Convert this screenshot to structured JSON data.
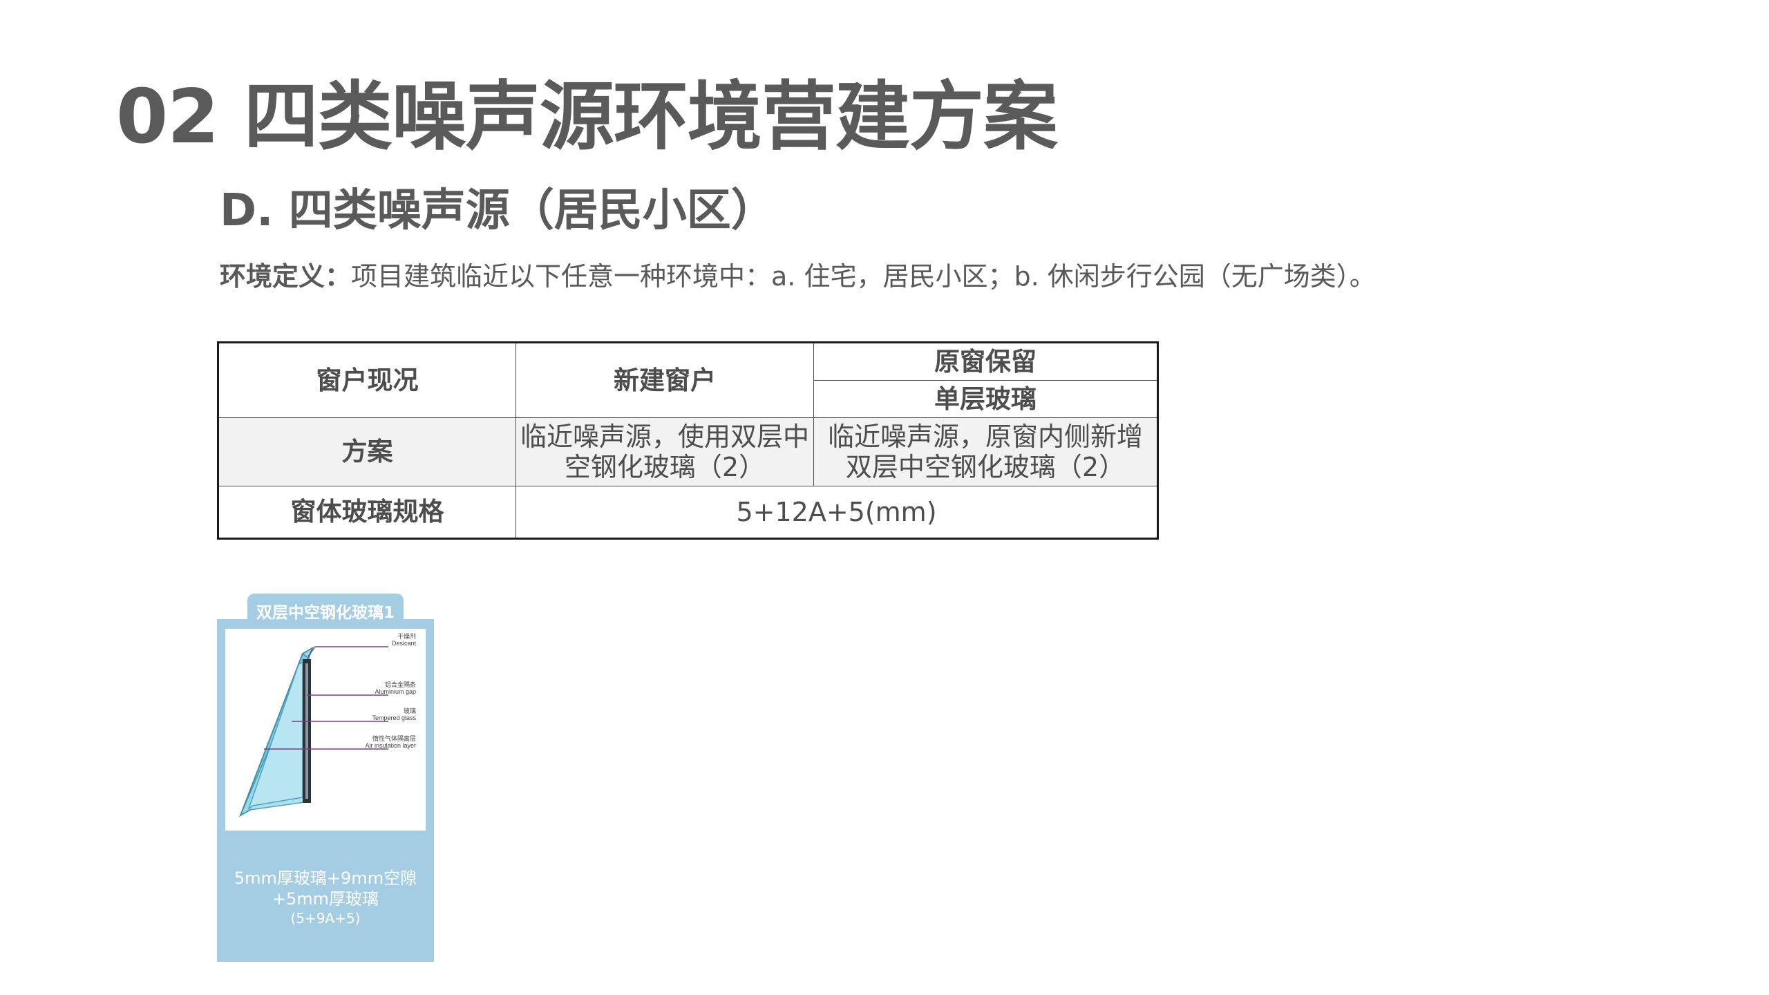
{
  "slide": {
    "title": "02 四类噪声源环境营建方案",
    "section_title": "D. 四类噪声源（居民小区）",
    "definition_label": "环境定义：",
    "definition_text": "项目建筑临近以下任意一种环境中：a. 住宅，居民小区；b. 休闲步行公园（无广场类）。"
  },
  "table": {
    "header": {
      "col1": "窗户现况",
      "col2": "新建窗户",
      "col3_top": "原窗保留",
      "col3_bottom": "单层玻璃"
    },
    "plan_row": {
      "label": "方案",
      "new_window": "临近噪声源，使用双层中空钢化玻璃（2）",
      "keep_window": "临近噪声源，原窗内侧新增双层中空钢化玻璃（2）"
    },
    "spec_row": {
      "label": "窗体玻璃规格",
      "value": "5+12A+5(mm)"
    }
  },
  "glass_card": {
    "tab_label": "双层中空钢化玻璃1",
    "diagram_labels": {
      "desiccant_cn": "干燥剂",
      "desiccant_en": "Desicant",
      "aluminum_cn": "铝合金隔条",
      "aluminum_en": "Aluminium gap",
      "tempered_cn": "玻璃",
      "tempered_en": "Tempered glass",
      "air_cn": "惰性气体隔离层",
      "air_en": "Air insulation layer"
    },
    "caption_line1": "5mm厚玻璃+9mm空隙",
    "caption_line2": "+5mm厚玻璃",
    "caption_line3": "(5+9A+5)"
  },
  "colors": {
    "title_text": "#5a5a5a",
    "card_background": "#a4cde3",
    "glass_tint": "#7ccbe0",
    "leader_line": "#7b3f7f"
  }
}
